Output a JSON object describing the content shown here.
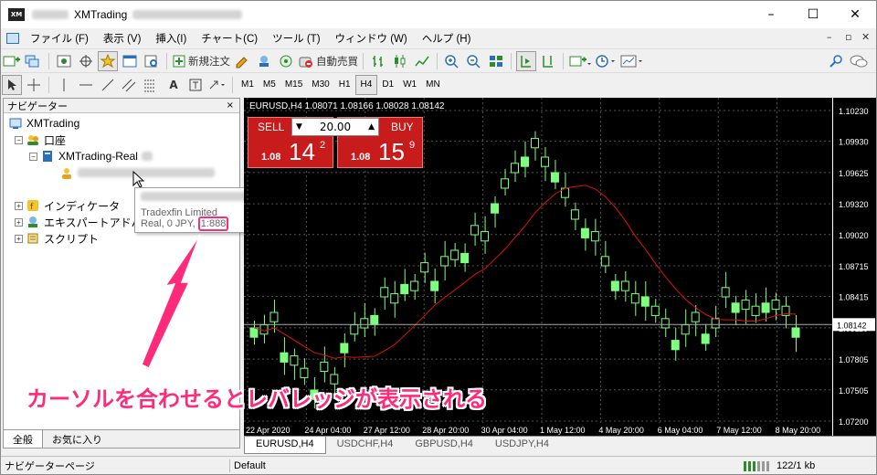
{
  "window": {
    "title": "XMTrading",
    "logo": "XM",
    "controls": [
      "–",
      "☐",
      "✕"
    ]
  },
  "menu": {
    "items": [
      "ファイル (F)",
      "表示 (V)",
      "挿入(I)",
      "チャート(C)",
      "ツール (T)",
      "ウィンドウ (W)",
      "ヘルプ (H)"
    ],
    "mdi": [
      "–",
      "▫",
      "✕"
    ]
  },
  "toolbar": {
    "new_order": "新規注文",
    "auto_trading": "自動売買",
    "timeframes": [
      "M1",
      "M5",
      "M15",
      "M30",
      "H1",
      "H4",
      "D1",
      "W1",
      "MN"
    ],
    "active_tf": "H4"
  },
  "navigator": {
    "title": "ナビゲーター",
    "close": "×",
    "root": "XMTrading",
    "accounts": "口座",
    "account_server": "XMTrading-Real",
    "indicators": "インディケータ",
    "experts": "エキスパートアドバイザ",
    "scripts": "スクリプト",
    "tabs": [
      "全般",
      "お気に入り"
    ]
  },
  "tooltip": {
    "company": "Tradexfin Limited",
    "account_type": "Real, 0 JPY,",
    "leverage": "1:888"
  },
  "chart": {
    "symbol_info": "EURUSD,H4  1.08071 1.08166 1.08028 1.08142",
    "sell_label": "SELL",
    "buy_label": "BUY",
    "lot": "20.00",
    "sell_prefix": "1.08",
    "sell_big": "14",
    "sell_sup": "2",
    "buy_prefix": "1.08",
    "buy_big": "15",
    "buy_sup": "9",
    "current_price": "1.08142",
    "price_ticks": [
      "1.10230",
      "1.09930",
      "1.09625",
      "1.09320",
      "1.09020",
      "1.08715",
      "1.08415",
      "1.08110",
      "1.07805",
      "1.07505",
      "1.07200"
    ],
    "time_ticks": [
      "22 Apr 2020",
      "24 Apr 04:00",
      "27 Apr 12:00",
      "28 Apr 20:00",
      "30 Apr 04:00",
      "1 May 12:00",
      "4 May 20:00",
      "6 May 04:00",
      "7 May 12:00",
      "8 May 20:00"
    ]
  },
  "chart_tabs": [
    "EURUSD,H4",
    "USDCHF,H4",
    "GBPUSD,H4",
    "USDJPY,H4"
  ],
  "status": {
    "left": "ナビゲーターページ",
    "profile": "Default",
    "traffic": "122/1 kb"
  },
  "annotation": "カーソルを合わせるとレバレッジが表示される",
  "colors": {
    "accent": "#ff2b7a",
    "candle": "#7fff7f",
    "ma": "#e01010",
    "sell": "#c81b1b"
  }
}
